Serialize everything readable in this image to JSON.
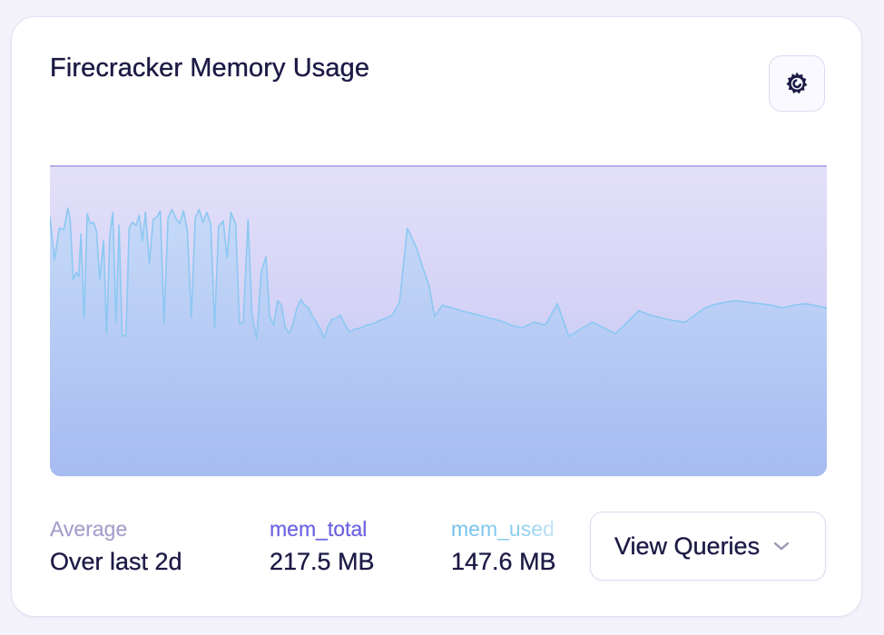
{
  "panel": {
    "title": "Firecracker Memory Usage",
    "settings_icon": "grafana-gear-icon"
  },
  "stats": {
    "average_label": "Average",
    "average_range": "Over last 2d",
    "mem_total_label": "mem_total",
    "mem_total_value": "217.5 MB",
    "mem_used_label": "mem_used",
    "mem_used_value": "147.6 MB"
  },
  "view_queries": {
    "label": "View Queries",
    "icon": "chevron-down-icon"
  },
  "colors": {
    "title": "#1c1a45",
    "mem_total": "#6d63e0",
    "mem_used": "#8fd0ef",
    "chart_fill_top": "#e2dff9",
    "chart_fill_bottom": "#a8bcf0",
    "mem_used_line": "#8cc8f2",
    "mem_total_line": "#8f88dc"
  },
  "chart_data": {
    "type": "area",
    "title": "Firecracker Memory Usage",
    "xlabel": "",
    "ylabel": "",
    "ylim": [
      0,
      217.5
    ],
    "grid": false,
    "legend": "none",
    "x": [
      0,
      0.6,
      1.2,
      1.8,
      2.3,
      2.6,
      3.0,
      3.4,
      3.7,
      4.0,
      4.4,
      4.8,
      5.2,
      5.6,
      6.0,
      6.4,
      6.9,
      7.3,
      7.7,
      8.1,
      8.5,
      8.9,
      9.3,
      9.8,
      10.2,
      10.6,
      11.1,
      11.5,
      11.9,
      12.3,
      12.8,
      13.3,
      13.8,
      14.2,
      14.7,
      15.2,
      15.7,
      16.2,
      16.7,
      17.2,
      17.7,
      18.2,
      18.7,
      19.2,
      19.7,
      20.2,
      20.7,
      21.2,
      21.7,
      22.3,
      22.8,
      23.3,
      23.9,
      24.4,
      24.9,
      25.5,
      26.0,
      26.6,
      27.2,
      27.8,
      28.3,
      28.8,
      29.3,
      29.8,
      30.3,
      30.8,
      31.3,
      31.8,
      32.3,
      32.8,
      33.3,
      33.8,
      34.3,
      34.8,
      35.3,
      35.8,
      36.3,
      36.9,
      37.4,
      38.0,
      38.6,
      39.2,
      40.0,
      40.8,
      41.6,
      42.4,
      43.3,
      44.1,
      45.0,
      46.0,
      47.2,
      48.0,
      48.8,
      49.5,
      50.5,
      51.8,
      53.0,
      54.4,
      55.8,
      57.2,
      58.5,
      59.3,
      60.8,
      62.3,
      63.8,
      65.3,
      66.8,
      68.3,
      69.8,
      71.3,
      72.8,
      74.3,
      75.8,
      77.3,
      78.8,
      80.3,
      81.8,
      83.3,
      84.3,
      85.3,
      86.8,
      88.3,
      89.8,
      91.3,
      92.8,
      94.3,
      95.8,
      97.3,
      100
    ],
    "series": [
      {
        "name": "mem_used",
        "values": [
          182,
          152,
          174,
          173,
          188,
          180,
          138,
          143,
          140,
          170,
          111,
          184,
          177,
          178,
          172,
          138,
          165,
          100,
          168,
          185,
          108,
          176,
          99,
          98,
          174,
          178,
          176,
          183,
          165,
          185,
          149,
          180,
          182,
          186,
          107,
          181,
          187,
          181,
          177,
          186,
          172,
          111,
          181,
          187,
          178,
          185,
          177,
          104,
          175,
          179,
          153,
          185,
          177,
          107,
          108,
          180,
          114,
          96,
          143,
          154,
          112,
          106,
          123,
          120,
          104,
          100,
          107,
          118,
          124,
          120,
          118,
          112,
          108,
          103,
          97,
          105,
          110,
          111,
          113,
          106,
          101,
          103,
          104,
          106,
          107,
          109,
          111,
          113,
          122,
          174,
          160,
          146,
          134,
          112,
          120,
          118,
          116,
          114,
          112,
          110,
          108,
          106,
          104,
          108,
          106,
          121,
          98,
          103,
          108,
          104,
          100,
          108,
          116,
          113,
          111,
          109,
          108,
          114,
          118,
          120,
          122,
          123,
          122,
          121,
          120,
          118,
          120,
          121,
          118
        ]
      },
      {
        "name": "mem_total",
        "values": [
          217.5,
          217.5
        ]
      }
    ]
  }
}
